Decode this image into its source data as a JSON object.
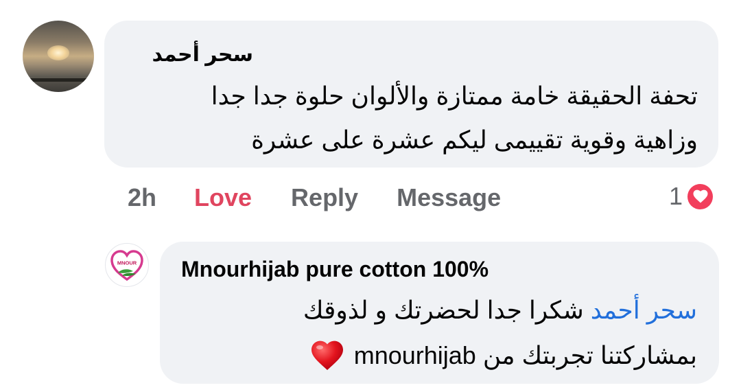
{
  "comment": {
    "author": "سحر أحمد",
    "text_line1": "تحفة الحقيقة خامة ممتازة والألوان حلوة جدا جدا",
    "text_line2": "وزاهية وقوية تقييمى ليكم عشرة على عشرة",
    "time": "2h",
    "actions": {
      "love_label": "Love",
      "reply_label": "Reply",
      "message_label": "Message"
    },
    "reaction": {
      "count": "1",
      "icon": "heart-icon",
      "color": "#f23e5c"
    },
    "avatar_icon": "sunset-avatar"
  },
  "reply": {
    "author": "Mnourhijab pure cotton 100%",
    "mention": "سحر أحمد",
    "text_line1": "شكرا جدا لحضرتك و لذوقك",
    "text_line2": "بمشاركتنا تجربتك من mnourhijab",
    "emoji": "red-heart-emoji",
    "avatar_logo_text": "MNOUR"
  },
  "colors": {
    "bubble": "#f0f2f5",
    "love": "#e0455f",
    "mention": "#216fdb",
    "meta_text": "#65676b"
  }
}
